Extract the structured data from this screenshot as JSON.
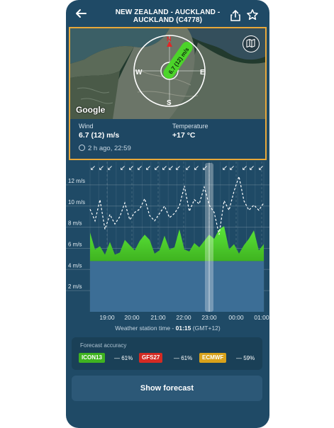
{
  "header": {
    "title_line1": "NEW ZEALAND - AUCKLAND -",
    "title_line2": "AUCKLAND (C4778)",
    "back_icon": "arrow-left-icon",
    "share_icon": "share-icon",
    "favorite_icon": "star-icon"
  },
  "map": {
    "provider_label": "Google",
    "compass": {
      "n": "N",
      "e": "E",
      "s": "S",
      "w": "W"
    },
    "wind_badge": "6.7 (12) m/s",
    "layers_icon": "map-layers-icon"
  },
  "station": {
    "wind_label": "Wind",
    "wind_value": "6.7 (12) m/s",
    "temp_label": "Temperature",
    "temp_value": "+17 °C",
    "time_ago": "2 h ago, 22:59"
  },
  "chart_data": {
    "type": "area",
    "x_ticks": [
      "19:00",
      "20:00",
      "21:00",
      "22:00",
      "23:00",
      "00:00",
      "01:00"
    ],
    "y_ticks": [
      "2 m/s",
      "4 m/s",
      "6 m/s",
      "8 m/s",
      "10 m/s",
      "12 m/s"
    ],
    "ylim": [
      0,
      13
    ],
    "series": [
      {
        "kind": "forecast",
        "values": [
          4.8,
          4.8,
          4.8,
          4.8,
          4.8,
          4.8,
          4.8,
          4.8,
          4.8,
          4.8,
          4.8,
          4.8,
          4.8,
          4.8,
          4.8,
          4.8,
          4.8,
          4.8,
          4.8,
          4.8,
          4.8,
          4.8,
          4.8,
          4.8,
          4.8,
          4.8,
          4.8,
          4.8,
          4.8,
          4.8,
          4.8,
          4.8,
          4.8,
          4.8,
          4.8,
          4.8
        ]
      },
      {
        "kind": "wind_avg",
        "values": [
          7.5,
          5.9,
          6.2,
          5.4,
          6.6,
          5.4,
          5.6,
          6.8,
          6.3,
          5.8,
          6.7,
          7.3,
          6.8,
          5.5,
          5.8,
          7.2,
          5.9,
          6.1,
          7.8,
          5.9,
          5.7,
          6.5,
          6.1,
          6.7,
          7.3,
          6.9,
          7.8,
          8.1,
          5.9,
          6.4,
          5.5,
          6.3,
          6.9,
          7.7,
          5.8,
          6.4
        ]
      },
      {
        "kind": "wind_gust",
        "values": [
          9.7,
          8.6,
          10.6,
          7.8,
          9.2,
          8.3,
          9.0,
          10.3,
          8.7,
          9.4,
          9.7,
          10.7,
          9.1,
          8.6,
          9.3,
          10.0,
          8.9,
          9.3,
          10.0,
          11.9,
          9.5,
          10.6,
          10.2,
          11.8,
          10.1,
          9.4,
          7.3,
          10.5,
          9.6,
          11.4,
          12.8,
          10.5,
          9.6,
          10.1,
          9.6,
          10.3
        ]
      }
    ],
    "arrow_glyph": "↙",
    "selected_time": "23:00"
  },
  "station_time": {
    "prefix": "Weather station time -",
    "value": "01:15",
    "suffix": "(GMT+12)"
  },
  "accuracy": {
    "title": "Forecast accuracy",
    "models": [
      {
        "name": "ICON13",
        "pct": "— 61%",
        "color": "#3fb320"
      },
      {
        "name": "GFS27",
        "pct": "— 61%",
        "color": "#d42a23"
      },
      {
        "name": "ECMWF",
        "pct": "— 59%",
        "color": "#d9a21b"
      }
    ]
  },
  "show_forecast_label": "Show forecast",
  "colors": {
    "background": "#1f4a66",
    "highlight_border": "#e8a83a",
    "wind_fill": "#4cd42a",
    "forecast_fill": "#3c6e96"
  }
}
